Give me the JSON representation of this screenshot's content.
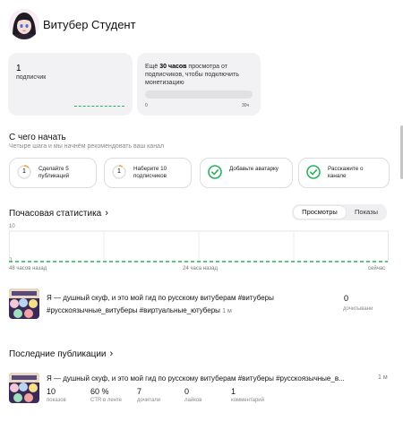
{
  "channel": {
    "name": "Витубер Студент"
  },
  "subscribers": {
    "count": "1",
    "label": "подписчик"
  },
  "monetization": {
    "text_prefix": "Ещё",
    "text_bold": "30 часов",
    "text_suffix": "просмотра от подписчиков, чтобы подключить монетизацию",
    "progress_fraction": 0,
    "min_label": "0",
    "max_label": "30ч"
  },
  "getting_started": {
    "title": "С чего начать",
    "subtitle": "Четыре шага и мы начнём рекомендовать ваш канал",
    "steps": [
      {
        "state": "progress",
        "icon_text": "1",
        "label": "Сделайте 5 публикаций"
      },
      {
        "state": "progress",
        "icon_text": "1",
        "label": "Наберите 10 подписчиков"
      },
      {
        "state": "done",
        "label": "Добавьте аватарку"
      },
      {
        "state": "done",
        "label": "Расскажите о канале"
      }
    ]
  },
  "hourly_stats": {
    "title": "Почасовая статистика",
    "tabs": [
      "Просмотры",
      "Показы"
    ],
    "active_tab": "Просмотры",
    "chart_data": {
      "type": "line",
      "x": [
        "48 часов назад",
        "24 часа назад",
        "сейчас"
      ],
      "series": [
        {
          "values": [
            0,
            0,
            0
          ]
        }
      ],
      "ylim": [
        0,
        10
      ],
      "y_ticks": [
        "10",
        "0"
      ],
      "grid": true
    }
  },
  "top_video": {
    "title": "Я — душный скуф, и это мой гид по русскому витуберам #витуберы #русскоязычные_витуберы #виртуальные_ютуберы",
    "age": "1 м",
    "stat_value": "0",
    "stat_label": "дочитывани"
  },
  "latest": {
    "title": "Последние публикации",
    "video": {
      "title": "Я — душный скуф, и это мой гид по русскому витуберам #витуберы #русскоязычные_в...",
      "age": "1 м",
      "metrics": [
        {
          "value": "10",
          "label": "показов"
        },
        {
          "value": "60 %",
          "label": "CTR в ленте"
        },
        {
          "value": "7",
          "label": "дочитали"
        },
        {
          "value": "0",
          "label": "лайков"
        },
        {
          "value": "1",
          "label": "комментарий"
        }
      ]
    }
  },
  "colors": {
    "accent": "#25b45a",
    "card_bg": "#f2f2f4"
  },
  "icons": {
    "chevron": "chevron-right-icon",
    "check": "check-icon"
  }
}
